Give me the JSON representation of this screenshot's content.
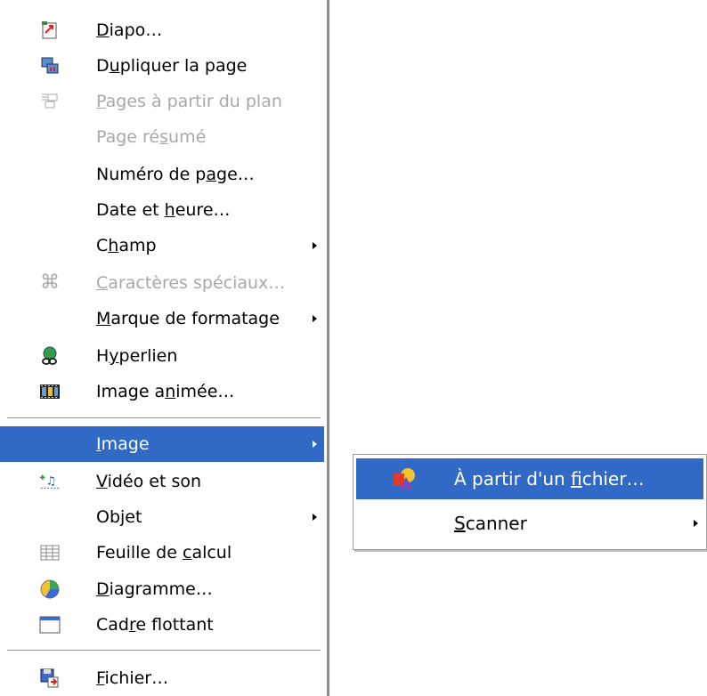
{
  "menu": {
    "items": [
      {
        "label": "Diapo…",
        "u": "D",
        "icon": "new-slide-icon"
      },
      {
        "label": "Dupliquer la page",
        "u": "u",
        "icon": "duplicate-page-icon"
      },
      {
        "label": "Pages à partir du plan",
        "u": "P",
        "icon": "expand-slide-icon",
        "disabled": true
      },
      {
        "label": "Page résumé",
        "u": "s",
        "disabled": true
      },
      {
        "label": "Numéro de page…",
        "u": "a"
      },
      {
        "label": "Date et heure…",
        "u": "h"
      },
      {
        "label": "Champ",
        "u": "h",
        "submenu": true
      },
      {
        "label": "Caractères spéciaux…",
        "u": "C",
        "icon": "special-character-icon",
        "disabled": true
      },
      {
        "label": "Marque de formatage",
        "u": "M",
        "submenu": true
      },
      {
        "label": "Hyperlien",
        "u": "y",
        "icon": "hyperlink-icon"
      },
      {
        "label": "Image animée…",
        "u": "n",
        "icon": "animated-image-icon"
      },
      {
        "label": "Image",
        "u": "I",
        "submenu": true,
        "active": true
      },
      {
        "label": "Vidéo et son",
        "u": "V",
        "icon": "video-sound-icon"
      },
      {
        "label": "Objet",
        "u": "j",
        "submenu": true
      },
      {
        "label": "Feuille de calcul",
        "u": "c",
        "icon": "spreadsheet-icon"
      },
      {
        "label": "Diagramme…",
        "u": "D",
        "icon": "chart-icon"
      },
      {
        "label": "Cadre flottant",
        "u": "r",
        "icon": "floating-frame-icon"
      },
      {
        "label": "Fichier…",
        "u": "F",
        "icon": "insert-file-icon"
      }
    ]
  },
  "submenu": {
    "items": [
      {
        "label": "À partir d'un fichier…",
        "u": "f",
        "icon": "from-file-icon",
        "active": true
      },
      {
        "label": "Scanner",
        "u": "S",
        "submenu": true
      }
    ]
  },
  "colors": {
    "highlight": "#3169c6",
    "disabled": "#a8a8a8"
  }
}
